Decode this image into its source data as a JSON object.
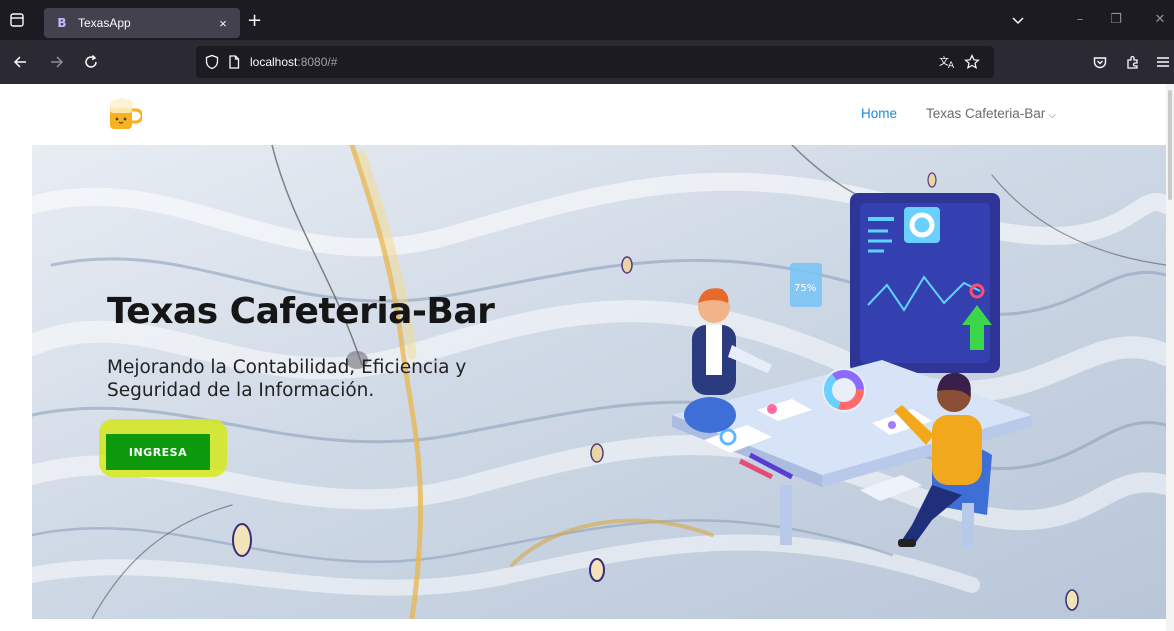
{
  "browser": {
    "tab_title": "TexasApp",
    "tab_favicon_letter": "B",
    "tab_close_glyph": "×",
    "new_tab_glyph": "+",
    "url_host": "localhost",
    "url_rest": ":8080/#",
    "icons": [
      "tab-list-icon",
      "back-icon",
      "forward-icon",
      "reload-icon",
      "tracking-shield-icon",
      "page-info-icon",
      "translate-icon",
      "bookmark-star-icon",
      "pocket-icon",
      "extensions-icon",
      "menu-icon",
      "tab-overflow-icon",
      "minimize-icon",
      "restore-icon",
      "close-window-icon"
    ],
    "window_glyphs": {
      "minimize": "–",
      "restore": "❐",
      "close": "✕"
    }
  },
  "site": {
    "nav": {
      "home": "Home",
      "cafe": "Texas Cafeteria-Bar",
      "cafe_chevron": "⌵"
    },
    "hero": {
      "title": "Texas Cafeteria-Bar",
      "subtitle": "Mejorando la Contabilidad, Eficiencia y Seguridad de la Información.",
      "button": "INGRESA"
    },
    "illustration": {
      "badge_text": "75%"
    }
  },
  "colors": {
    "accent_link": "#1a8ad6",
    "button_green": "#0c9a0c",
    "highlight_yellow": "#d5e81b",
    "chrome_dark": "#1c1b22",
    "chrome_toolbar": "#2b2a33"
  }
}
